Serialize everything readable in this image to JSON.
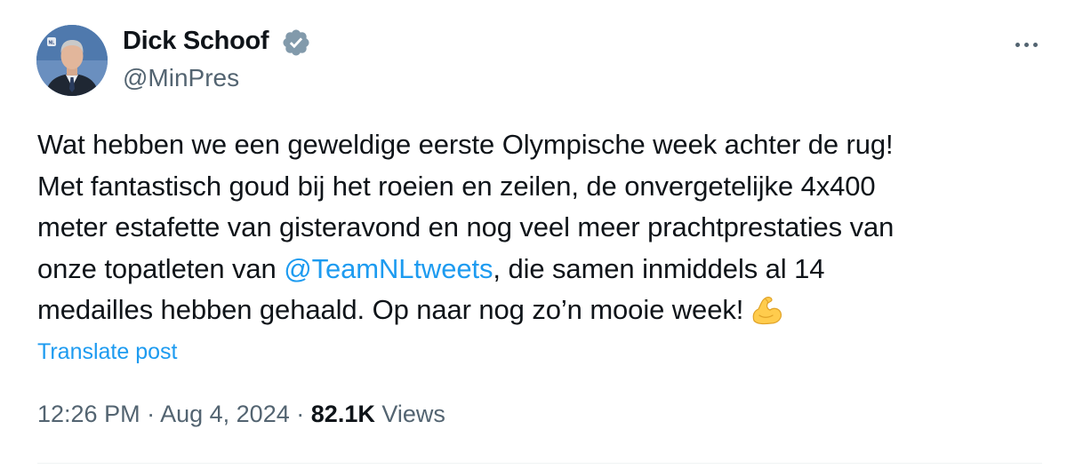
{
  "author": {
    "display_name": "Dick Schoof",
    "handle": "@MinPres",
    "verified_badge": "verified-badge-icon",
    "avatar_badge_text": "NL"
  },
  "post": {
    "lines": [
      "Wat hebben we een geweldige eerste Olympische week achter de rug!",
      "Met fantastisch goud bij het roeien en zeilen, de onvergetelijke 4x400",
      "meter estafette van gisteravond en nog veel meer prachtprestaties van"
    ],
    "line4_before": "onze topatleten van ",
    "mention": "@TeamNLtweets",
    "line4_after": ", die samen inmiddels al 14",
    "line5": "medailles hebben gehaald. Op naar nog zo’n mooie week!",
    "emoji": "flexed-biceps-icon"
  },
  "translate_label": "Translate post",
  "meta": {
    "time": "12:26 PM",
    "separator": "·",
    "date": "Aug 4, 2024",
    "views_count": "82.1K",
    "views_label": "Views"
  },
  "colors": {
    "link": "#1d9bf0",
    "verified": "#829aab",
    "secondary_text": "#536471",
    "primary_text": "#0f1419"
  }
}
